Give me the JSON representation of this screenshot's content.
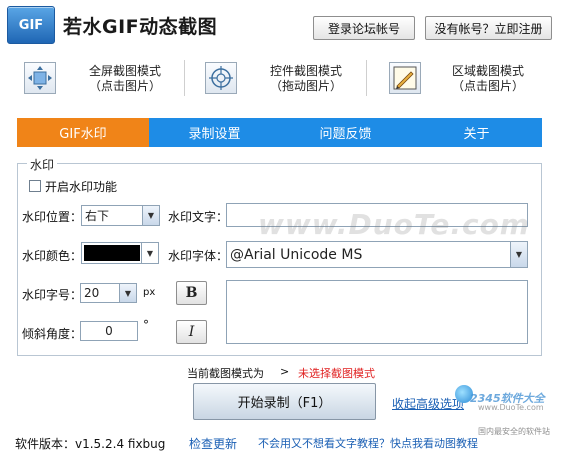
{
  "app": {
    "logo_text": "GIF",
    "title": "若水GIF动态截图",
    "login_label": "登录论坛帐号",
    "register_label": "没有帐号？立即注册"
  },
  "modes": [
    {
      "label": "全屏截图模式",
      "hint": "（点击图片）",
      "icon": "fullscreen-move-icon"
    },
    {
      "label": "控件截图模式",
      "hint": "（拖动图片）",
      "icon": "crosshair-icon"
    },
    {
      "label": "区域截图模式",
      "hint": "（点击图片）",
      "icon": "region-pencil-icon"
    }
  ],
  "tabs": [
    {
      "label": "GIF水印",
      "active": true
    },
    {
      "label": "录制设置",
      "active": false
    },
    {
      "label": "问题反馈",
      "active": false
    },
    {
      "label": "关于",
      "active": false
    }
  ],
  "watermark": {
    "legend": "水印",
    "enable_label": "开启水印功能",
    "enabled": false,
    "position_label": "水印位置：",
    "position_value": "右下",
    "text_label": "水印文字：",
    "text_value": "",
    "color_label": "水印颜色：",
    "color_value": "#000000",
    "font_label": "水印字体：",
    "font_value": "@Arial Unicode MS",
    "size_label": "水印字号：",
    "size_value": "20",
    "size_unit": "px",
    "bold_label": "B",
    "angle_label": "倾斜角度：",
    "angle_value": "0",
    "angle_unit": "°",
    "italic_label": "I"
  },
  "status": {
    "mode_prefix": "当前截图模式为",
    "arrow": ">",
    "mode_value": "未选择截图模式",
    "mode_value_color": "#e02020"
  },
  "actions": {
    "start_label": "开始录制（F1）",
    "collapse_label": "收起高级选项"
  },
  "footer": {
    "version_text": "软件版本：v1.5.2.4 fixbug",
    "check_update_label": "检查更新",
    "tutorial_text": "不会用又不想看文字教程？快点我看动图教程"
  },
  "overlays": {
    "watermark_site": "www.DuoTe.com",
    "logo_2345": "2345软件大全",
    "logo_2345_url": "www.DuoTe.com",
    "logo_2345_sub": "国内最安全的软件站"
  },
  "colors": {
    "tab_bar": "#1e8ce6",
    "tab_active": "#f08418",
    "link": "#1a5fb4"
  }
}
